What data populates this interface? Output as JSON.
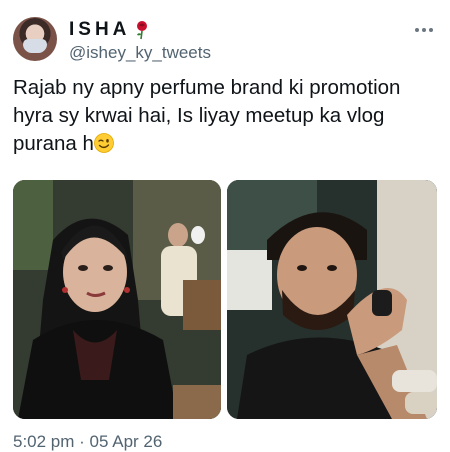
{
  "author": {
    "name": "ISHA",
    "handle": "@ishey_ky_tweets",
    "avatar": "avatar-profile-photo",
    "name_icon": "rose-icon"
  },
  "tweet": {
    "text": "Rajab ny apny perfume brand ki promotion hyra sy krwai hai, Is liyay meetup ka vlog purana h",
    "emoji": "wink-face-icon"
  },
  "media": {
    "left_photo": "photo-woman-restaurant",
    "right_photo": "photo-man-restaurant"
  },
  "footer": {
    "timestamp": "5:02 pm · 05 Apr 26"
  },
  "colors": {
    "text_primary": "#0f1419",
    "text_secondary": "#536471",
    "background": "#ffffff"
  }
}
